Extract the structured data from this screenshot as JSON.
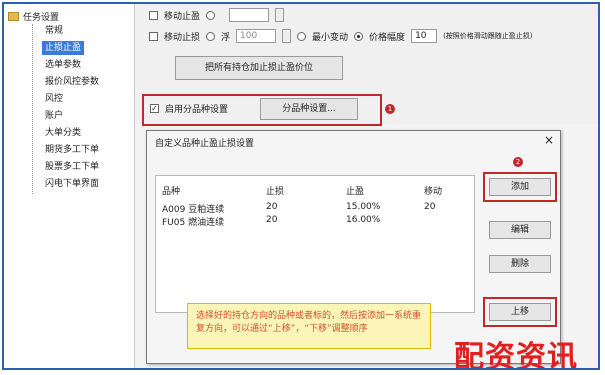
{
  "tree": {
    "root_label": "任务设置",
    "items": [
      "常规",
      "止损止盈",
      "选单参数",
      "报价风控参数",
      "风控",
      "账户",
      "大单分类",
      "期货多工下单",
      "股票多工下单",
      "闪电下单界面"
    ],
    "selected_index": 1
  },
  "settings": {
    "row1_label_a": "移动止盈",
    "row2_check_label": "移动止损",
    "row2_radio1": "浮",
    "row2_value": "100",
    "row2_radio2": "最小变动",
    "row2_radio3": "价格幅度",
    "row2_value2": "10",
    "row2_note": "(按照价格滑动跟随止盈止损)",
    "apply_button": "把所有持仓加止损止盈价位",
    "use_category": "启用分品种设置",
    "category_button": "分品种设置...",
    "badge1": "1"
  },
  "dialog": {
    "title": "自定义品种止盈止损设置",
    "close": "×",
    "headers": [
      "品种",
      "止损",
      "止盈",
      "移动"
    ],
    "rows": [
      [
        "A009 豆粕连续",
        "20",
        "15.00%",
        "20"
      ],
      [
        "FU05 燃油连续",
        "20",
        "16.00%",
        ""
      ]
    ],
    "add": "添加",
    "edit": "编辑",
    "delete": "删除",
    "up": "上移",
    "badge2": "2",
    "tip": "选择好的持仓方向的品种或者标的，然后按添加一系统重复方向，可以通过“上移”，“下移”调整顺序"
  },
  "watermark": "配资资讯"
}
